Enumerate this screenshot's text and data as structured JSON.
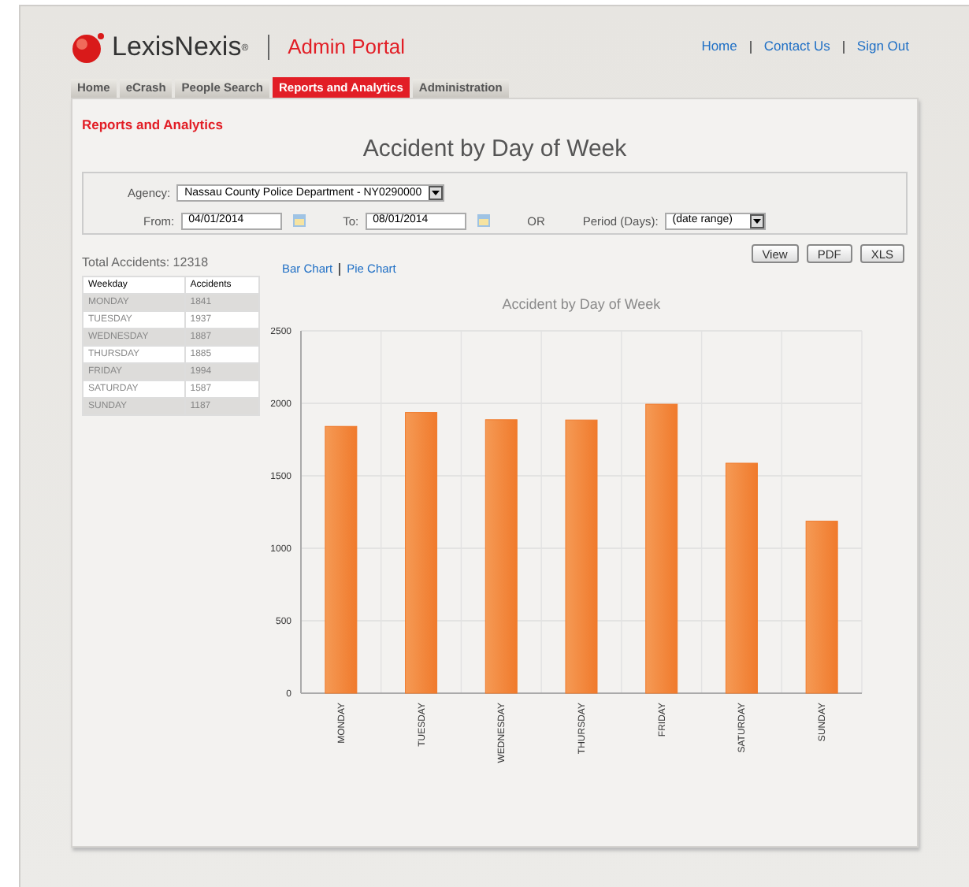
{
  "header": {
    "brand": "LexisNexis",
    "brand_mark": "®",
    "portal": "Admin Portal",
    "links": [
      "Home",
      "Contact Us",
      "Sign Out"
    ]
  },
  "tabs": [
    {
      "label": "Home",
      "selected": false
    },
    {
      "label": "eCrash",
      "selected": false
    },
    {
      "label": "People Search",
      "selected": false
    },
    {
      "label": "Reports and Analytics",
      "selected": true
    },
    {
      "label": "Administration",
      "selected": false
    }
  ],
  "section_title": "Reports and Analytics",
  "page_title": "Accident by Day of Week",
  "filters": {
    "agency_label": "Agency:",
    "agency_value": "Nassau County Police Department - NY0290000",
    "from_label": "From:",
    "from_value": "04/01/2014",
    "to_label": "To:",
    "to_value": "08/01/2014",
    "or": "OR",
    "period_label": "Period (Days):",
    "period_value": "(date range)"
  },
  "actions": [
    "View",
    "PDF",
    "XLS"
  ],
  "total": "Total Accidents: 12318",
  "table": {
    "columns": [
      "Weekday",
      "Accidents"
    ],
    "rows": [
      [
        "MONDAY",
        "1841"
      ],
      [
        "TUESDAY",
        "1937"
      ],
      [
        "WEDNESDAY",
        "1887"
      ],
      [
        "THURSDAY",
        "1885"
      ],
      [
        "FRIDAY",
        "1994"
      ],
      [
        "SATURDAY",
        "1587"
      ],
      [
        "SUNDAY",
        "1187"
      ]
    ]
  },
  "chart_links": [
    "Bar Chart",
    "Pie Chart"
  ],
  "chart_data": {
    "type": "bar",
    "title": "Accident by Day of Week",
    "categories": [
      "MONDAY",
      "TUESDAY",
      "WEDNESDAY",
      "THURSDAY",
      "FRIDAY",
      "SATURDAY",
      "SUNDAY"
    ],
    "grid": true,
    "series": [
      {
        "color": "#f07a2c",
        "values": [
          1841,
          1937,
          1887,
          1885,
          1994,
          1587,
          1187
        ]
      }
    ],
    "ylim": [
      0,
      2500
    ],
    "yticks": [
      0,
      500,
      1000,
      1500,
      2000,
      2500
    ]
  }
}
